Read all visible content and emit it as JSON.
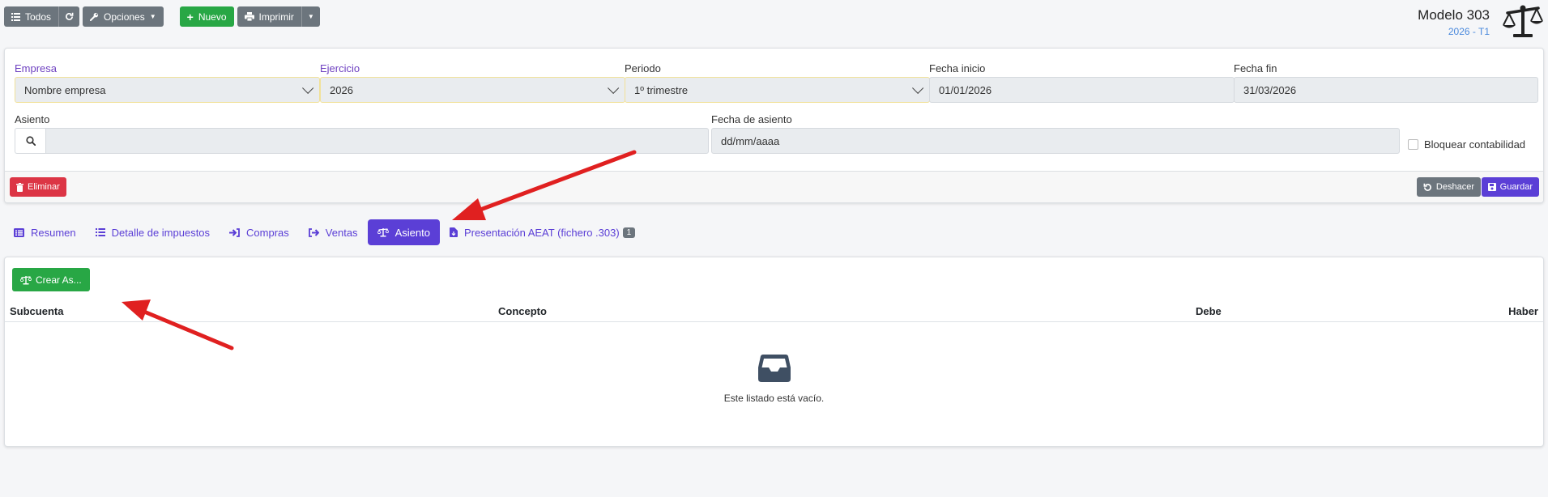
{
  "toolbar": {
    "all_label": "Todos",
    "options_label": "Opciones",
    "new_label": "Nuevo",
    "print_label": "Imprimir"
  },
  "header": {
    "title": "Modelo 303",
    "subtitle": "2026 - T1"
  },
  "form": {
    "empresa_label": "Empresa",
    "empresa_value": "Nombre empresa",
    "ejercicio_label": "Ejercicio",
    "ejercicio_value": "2026",
    "periodo_label": "Periodo",
    "periodo_value": "1º trimestre",
    "fecha_inicio_label": "Fecha inicio",
    "fecha_inicio_value": "01/01/2026",
    "fecha_fin_label": "Fecha fin",
    "fecha_fin_value": "31/03/2026",
    "asiento_label": "Asiento",
    "asiento_value": "",
    "fecha_asiento_label": "Fecha de asiento",
    "fecha_asiento_placeholder": "dd/mm/aaaa",
    "lock_label": "Bloquear contabilidad"
  },
  "actions": {
    "delete_label": "Eliminar",
    "undo_label": "Deshacer",
    "save_label": "Guardar"
  },
  "tabs": [
    {
      "label": "Resumen",
      "icon": "list-alt-icon"
    },
    {
      "label": "Detalle de impuestos",
      "icon": "list-icon"
    },
    {
      "label": "Compras",
      "icon": "sign-in-icon"
    },
    {
      "label": "Ventas",
      "icon": "sign-out-icon"
    },
    {
      "label": "Asiento",
      "icon": "balance-scale-icon",
      "active": true
    },
    {
      "label": "Presentación AEAT (fichero .303)",
      "icon": "file-download-icon",
      "badge": "1"
    }
  ],
  "entries": {
    "create_label": "Crear As...",
    "columns": [
      "Subcuenta",
      "Concepto",
      "Debe",
      "Haber"
    ],
    "empty_message": "Este listado está vacío."
  },
  "colors": {
    "primary": "#5b3fd6",
    "success": "#28a745",
    "danger": "#dc3545",
    "secondary": "#6c757d",
    "annotation": "#e02020"
  }
}
